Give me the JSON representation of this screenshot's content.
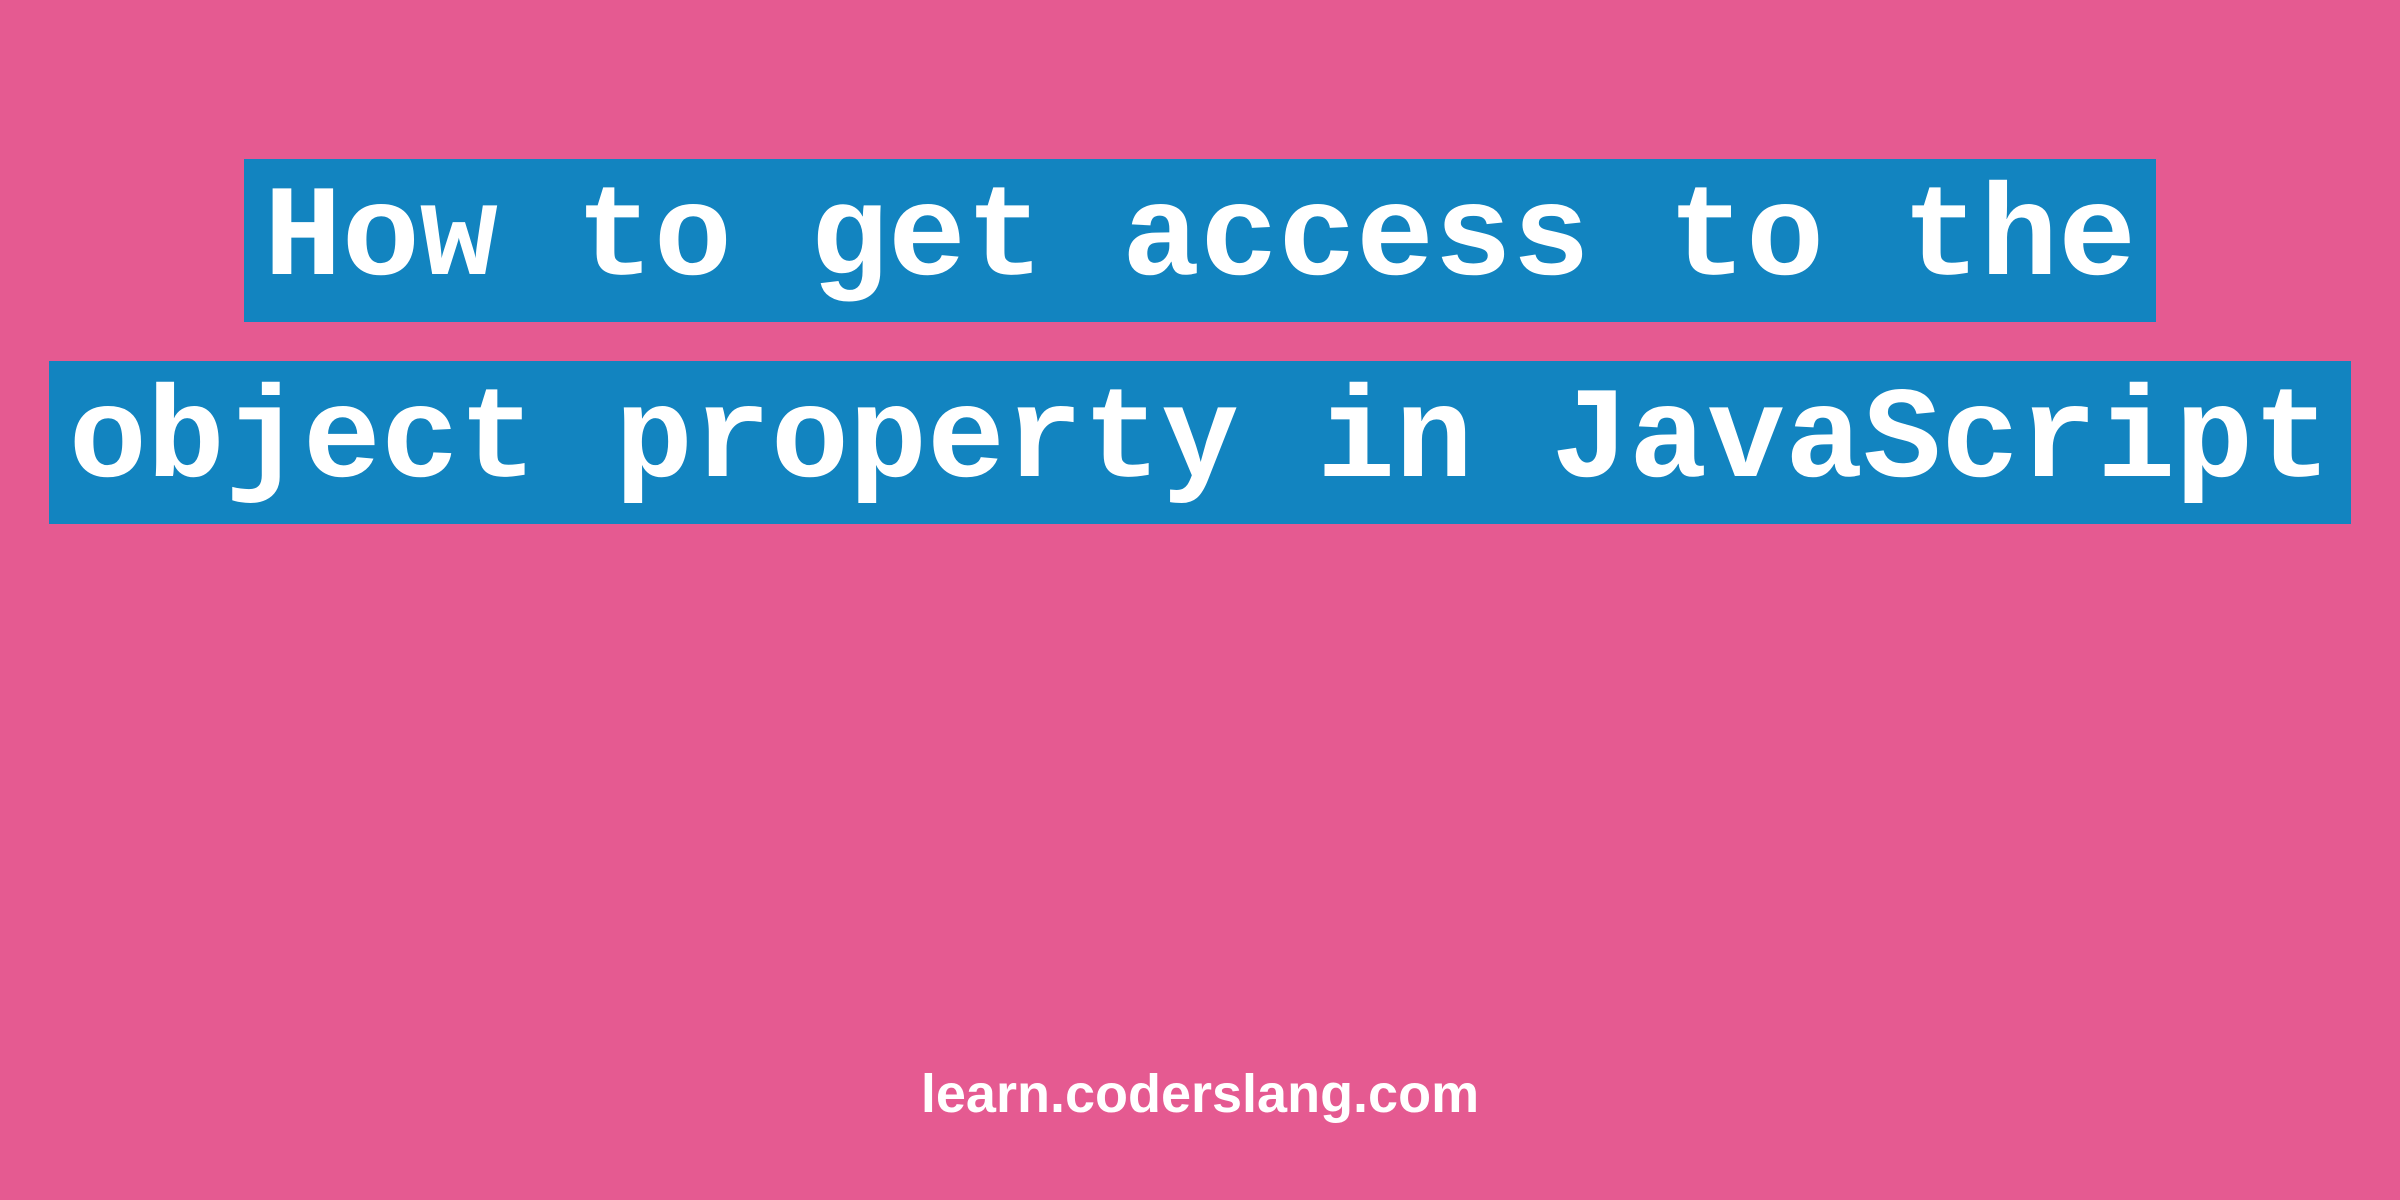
{
  "title": "How to get access to the object property in JavaScript",
  "footer": "learn.coderslang.com",
  "colors": {
    "background": "#e55a91",
    "highlight": "#1284c0",
    "text": "#ffffff"
  }
}
